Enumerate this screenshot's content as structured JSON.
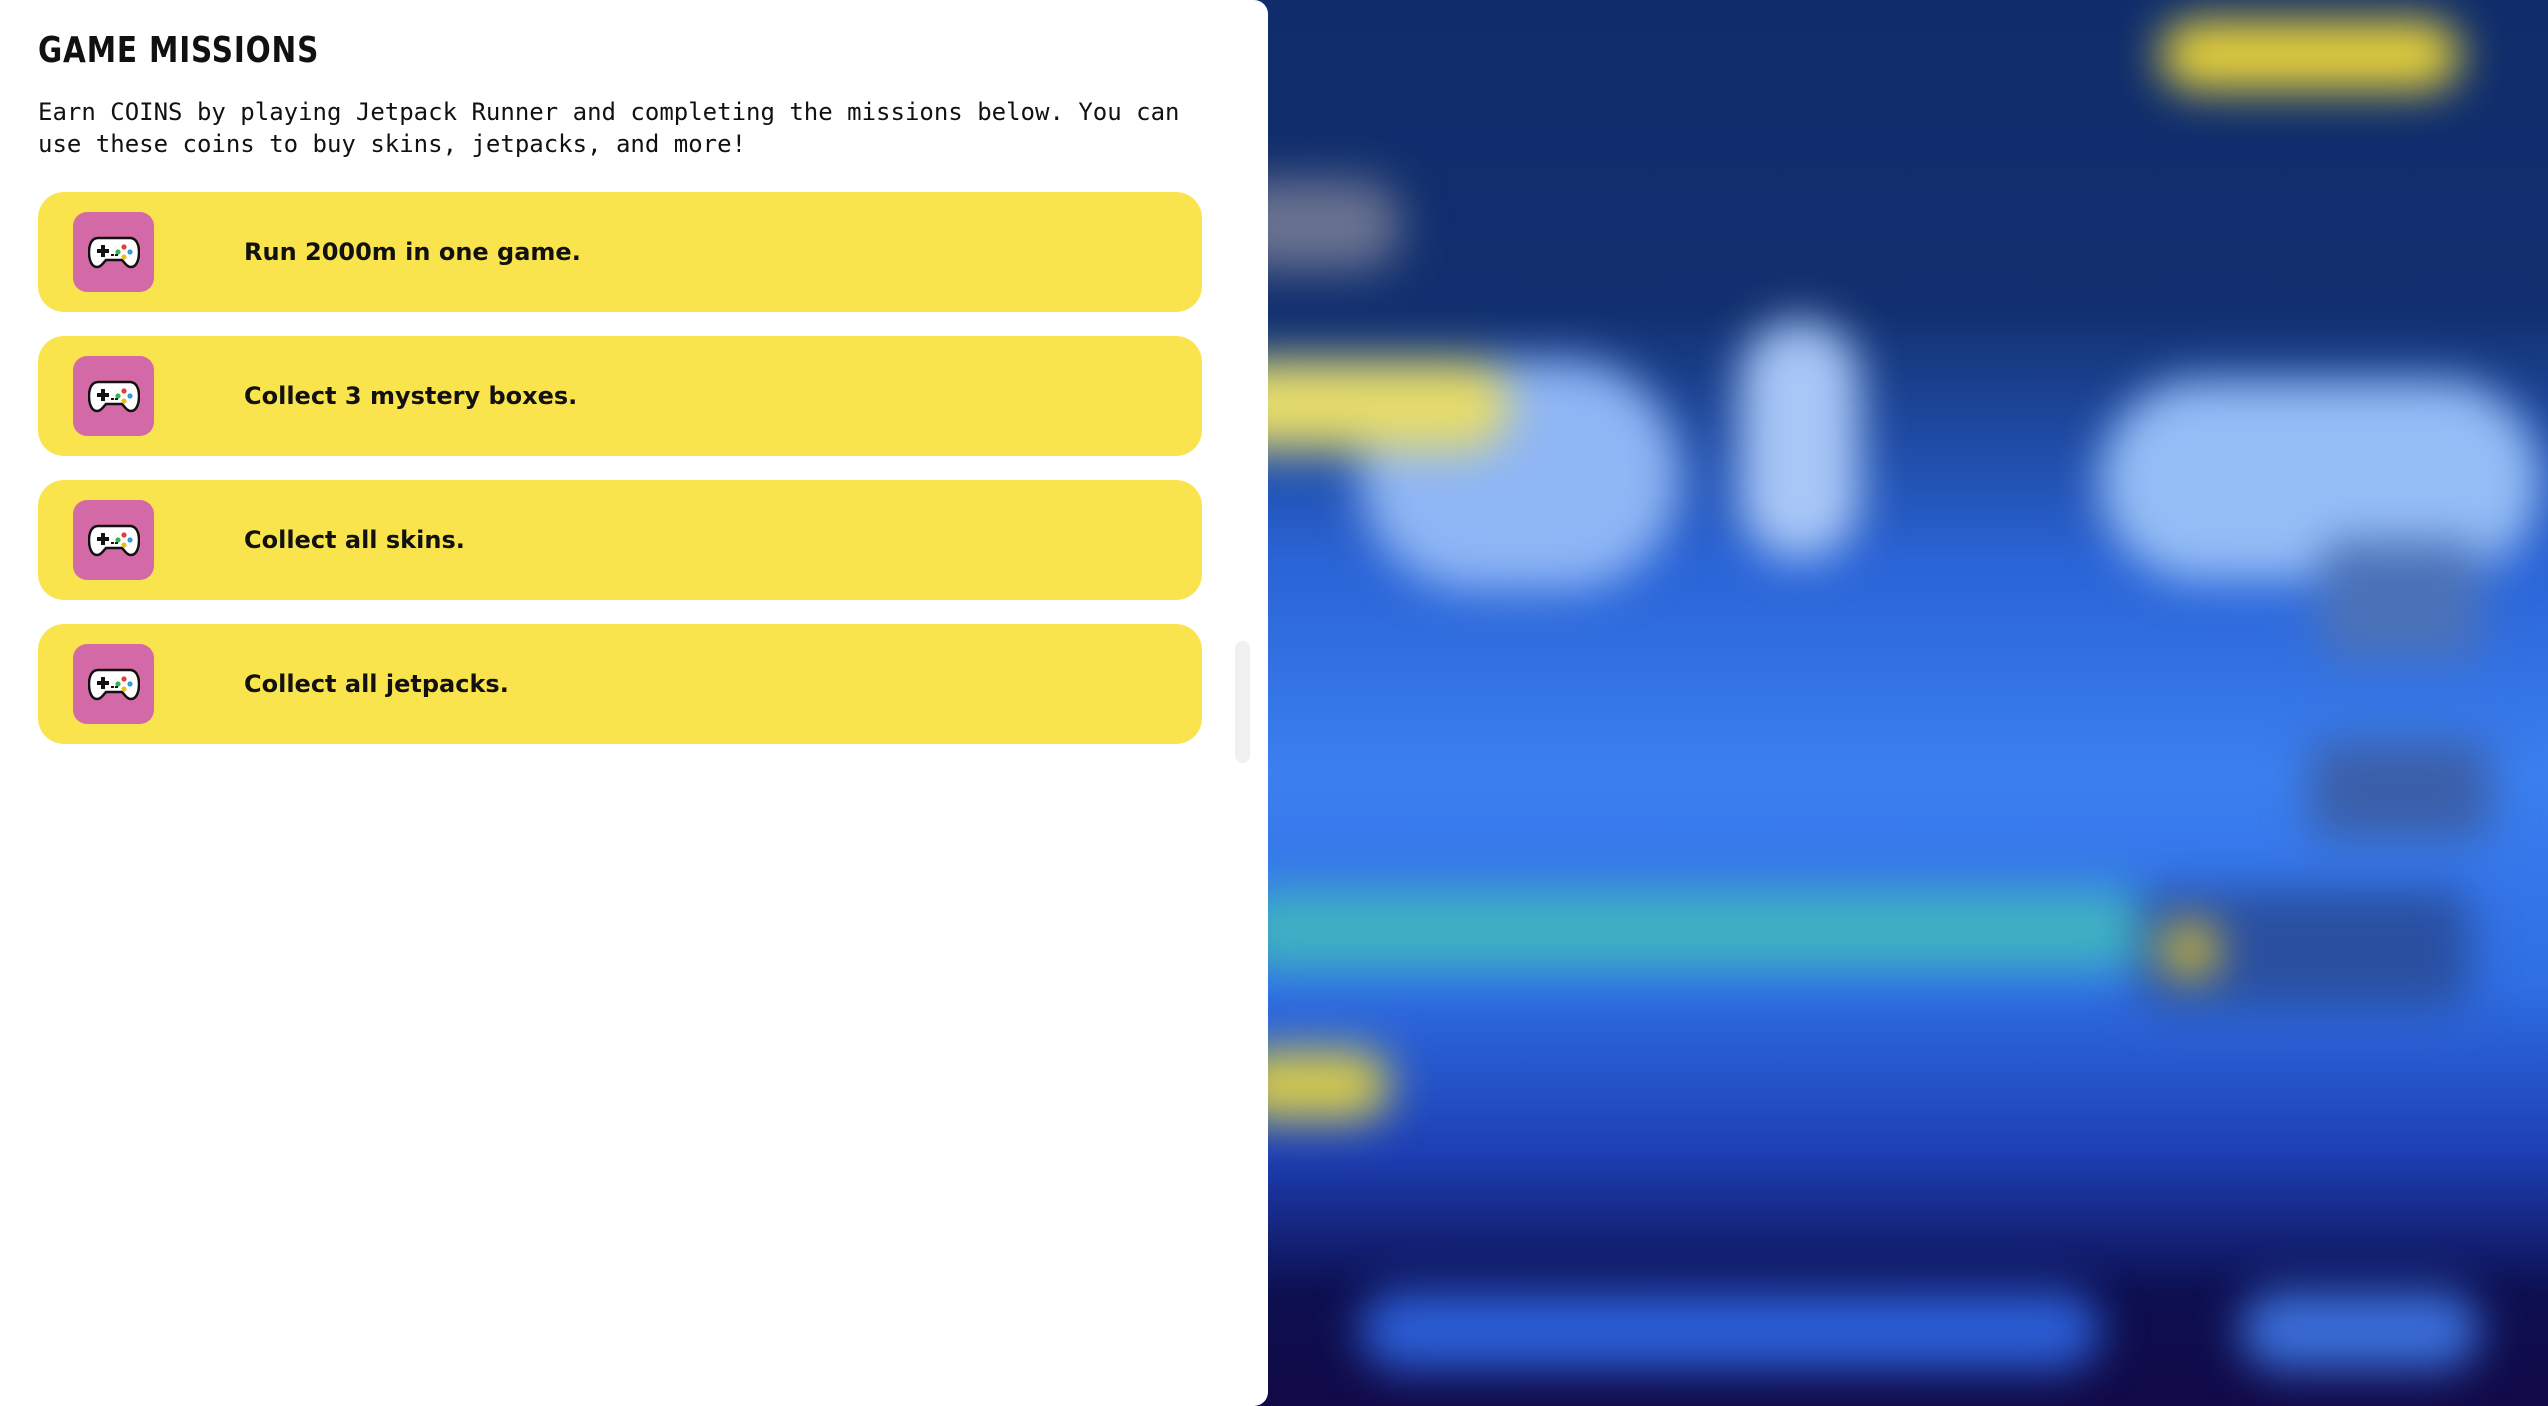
{
  "panel": {
    "title": "GAME MISSIONS",
    "description": "Earn COINS by playing Jetpack Runner and completing the missions below. You can use these coins to buy skins, jetpacks, and more!"
  },
  "missions": [
    {
      "label": "Run 2000m in one game.",
      "icon": "gamepad-icon"
    },
    {
      "label": "Collect 3 mystery boxes.",
      "icon": "gamepad-icon"
    },
    {
      "label": "Collect all skins.",
      "icon": "gamepad-icon"
    },
    {
      "label": "Collect all jetpacks.",
      "icon": "gamepad-icon"
    }
  ],
  "colors": {
    "mission_bg": "#fae44e",
    "icon_bg": "#d36aa7",
    "panel_bg": "#ffffff",
    "sky": "#0f2d6b",
    "game_blue": "#3b7ff0"
  }
}
